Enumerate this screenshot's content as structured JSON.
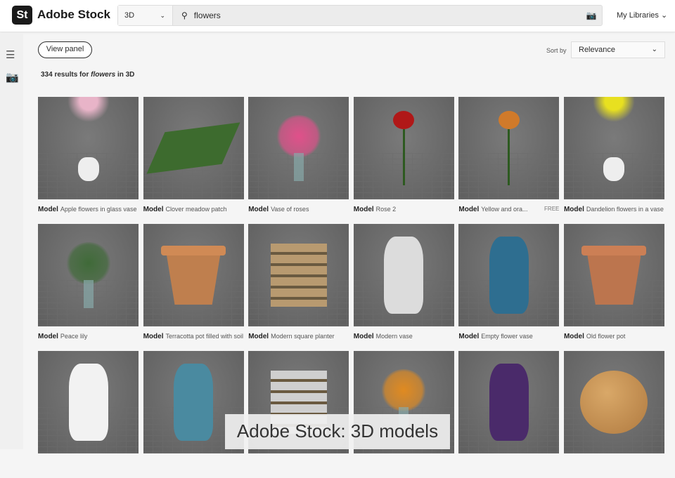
{
  "header": {
    "logo": "St",
    "brand": "Adobe Stock",
    "asset_type": "3D",
    "query": "flowers",
    "my_libraries": "My Libraries"
  },
  "sidebar": {
    "icons": [
      "filters-icon",
      "camera-icon"
    ]
  },
  "toolbar": {
    "view_panel": "View panel",
    "results_count": "334",
    "results_text": " results for ",
    "results_query": "flowers",
    "results_in": " in 3D",
    "sort_label": "Sort by",
    "sort_value": "Relevance"
  },
  "results": [
    {
      "type": "Model",
      "title": "Apple flowers in glass vase",
      "color": "#e8b4c8",
      "shape": "vase"
    },
    {
      "type": "Model",
      "title": "Clover meadow patch",
      "color": "#3d6b2e",
      "shape": "patch"
    },
    {
      "type": "Model",
      "title": "Vase of roses",
      "color": "#e0508a",
      "shape": "bouquet"
    },
    {
      "type": "Model",
      "title": "Rose 2",
      "color": "#b01818",
      "shape": "rose"
    },
    {
      "type": "Model",
      "title": "Yellow and ora...",
      "color": "#d07a2a",
      "shape": "rose",
      "badge": "FREE"
    },
    {
      "type": "Model",
      "title": "Dandelion flowers in a vase",
      "color": "#e8e020",
      "shape": "vase"
    },
    {
      "type": "Model",
      "title": "Peace lily",
      "color": "#3f6a38",
      "shape": "bouquet"
    },
    {
      "type": "Model",
      "title": "Terracotta pot filled with soil",
      "color": "#d08a55",
      "shape": "pot"
    },
    {
      "type": "Model",
      "title": "Modern square planter",
      "color": "#b89a70",
      "shape": "box"
    },
    {
      "type": "Model",
      "title": "Modern vase",
      "color": "#dcdcdc",
      "shape": "tall"
    },
    {
      "type": "Model",
      "title": "Empty flower vase",
      "color": "#2e6e90",
      "shape": "tall"
    },
    {
      "type": "Model",
      "title": "Old flower pot",
      "color": "#cc7f55",
      "shape": "pot"
    },
    {
      "type": "",
      "title": "",
      "color": "#f2f2f2",
      "shape": "tall"
    },
    {
      "type": "",
      "title": "",
      "color": "#4a8aa0",
      "shape": "tall"
    },
    {
      "type": "",
      "title": "",
      "color": "#cfcfcf",
      "shape": "box"
    },
    {
      "type": "",
      "title": "",
      "color": "#e08a20",
      "shape": "bouquet"
    },
    {
      "type": "",
      "title": "",
      "color": "#4a2a6a",
      "shape": "tall"
    },
    {
      "type": "",
      "title": "",
      "color": "#b07a40",
      "shape": "round"
    }
  ],
  "overlay_caption": "Adobe Stock: 3D models"
}
